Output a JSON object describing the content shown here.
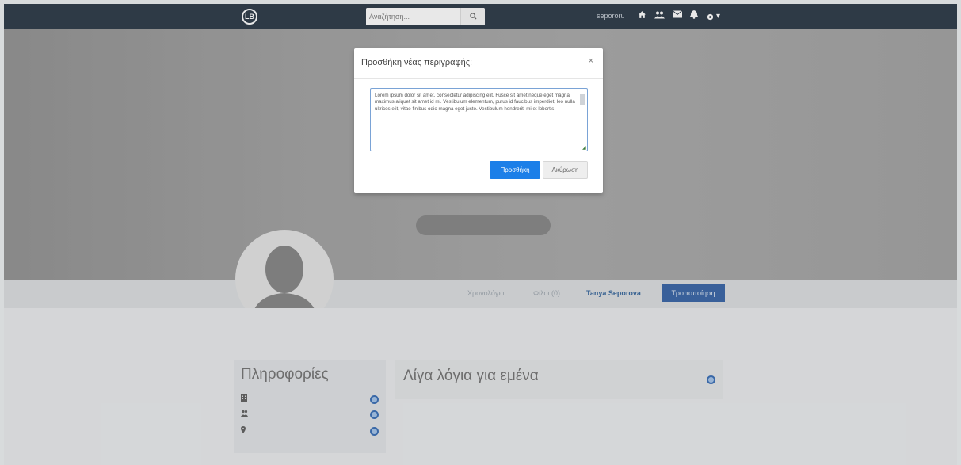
{
  "navbar": {
    "logo_text": "LB",
    "search": {
      "placeholder": "Αναζήτηση..."
    },
    "search_icon": "search-icon",
    "username": "sepororu",
    "icons": [
      "home-icon",
      "users-icon",
      "envelope-icon",
      "bell-icon",
      "gear-icon"
    ],
    "gear_caret": "▾"
  },
  "profile": {
    "tabs": [
      {
        "label": "Χρονολόγιο"
      },
      {
        "label": "Φίλοι (0)"
      },
      {
        "label": "Tanya Seporova"
      }
    ],
    "edit_button": "Τροποποίηση"
  },
  "info_card": {
    "title": "Πληροφορίες",
    "rows": [
      {
        "icon": "building-icon"
      },
      {
        "icon": "people-icon"
      },
      {
        "icon": "map-marker-icon"
      }
    ]
  },
  "about_card": {
    "title": "Λίγα λόγια για εμένα"
  },
  "modal": {
    "title": "Προσθήκη νέας περιγραφής:",
    "close": "×",
    "textarea_value": "Lorem ipsum dolor sit amet, consectetur adipiscing elit. Fusce sit amet neque eget magna maximus aliquet sit amet id mi. Vestibulum elementum, purus id faucibus imperdiet, leo nulla ultrices elit, vitae finibus odio magna eget justo. Vestibulum hendrerit, mi et lobortis",
    "add_button": "Προσθήκη",
    "cancel_button": "Ακύρωση"
  },
  "colors": {
    "navbar": "#1d2b3a",
    "primary_button": "#1c7fe8",
    "accent_blue": "#2a5aa0"
  }
}
